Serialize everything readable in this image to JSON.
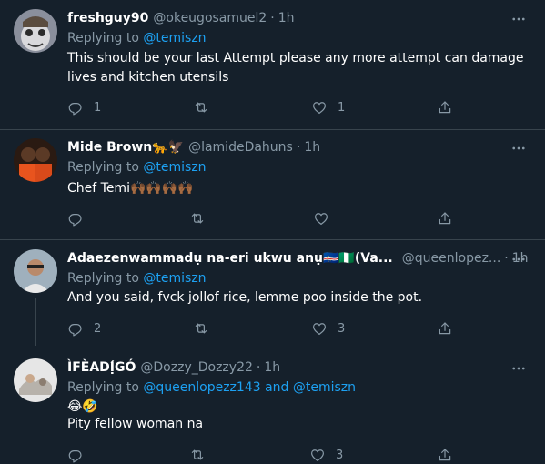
{
  "tweets": [
    {
      "name": "freshguy90",
      "handle": "@okeugosamuel2",
      "dot": "·",
      "time": "1h",
      "replying_label": "Replying to",
      "replying_to": "@temiszn",
      "text": "This should be your last Attempt please any more attempt can damage lives and kitchen utensils",
      "reply_count": "1",
      "retweet_count": "",
      "like_count": "1"
    },
    {
      "name": "Mide Brown🐆🦅",
      "handle": "@lamideDahuns",
      "dot": "·",
      "time": "1h",
      "replying_label": "Replying to",
      "replying_to": "@temiszn",
      "text": "Chef Temi🙌🏾🙌🏾🙌🏾🙌🏾",
      "reply_count": "",
      "retweet_count": "",
      "like_count": ""
    },
    {
      "name": "Adaezenwammadụ na-eri ukwu anụ🇨🇻🇳🇬(Va...",
      "handle": "@queenlopez...",
      "dot": "·",
      "time": "1h",
      "replying_label": "Replying to",
      "replying_to": "@temiszn",
      "text": "And you said, fvck jollof rice, lemme poo inside the pot.",
      "reply_count": "2",
      "retweet_count": "",
      "like_count": "3"
    },
    {
      "name": "ÌFÈADỊ́GÓ",
      "handle": "@Dozzy_Dozzy22",
      "dot": "·",
      "time": "1h",
      "replying_label": "Replying to",
      "replying_to": "@queenlopezz143 and @temiszn",
      "text_line1": "😂🤣",
      "text_line2": "Pity fellow woman na",
      "reply_count": "",
      "retweet_count": "",
      "like_count": "3"
    }
  ],
  "icons": {
    "more": "more-horizontal-icon",
    "reply": "reply-icon",
    "retweet": "retweet-icon",
    "like": "heart-icon",
    "share": "share-icon"
  },
  "colors": {
    "background": "#15202b",
    "muted": "#8899a6",
    "link": "#1da1f2",
    "divider": "#38444d"
  }
}
